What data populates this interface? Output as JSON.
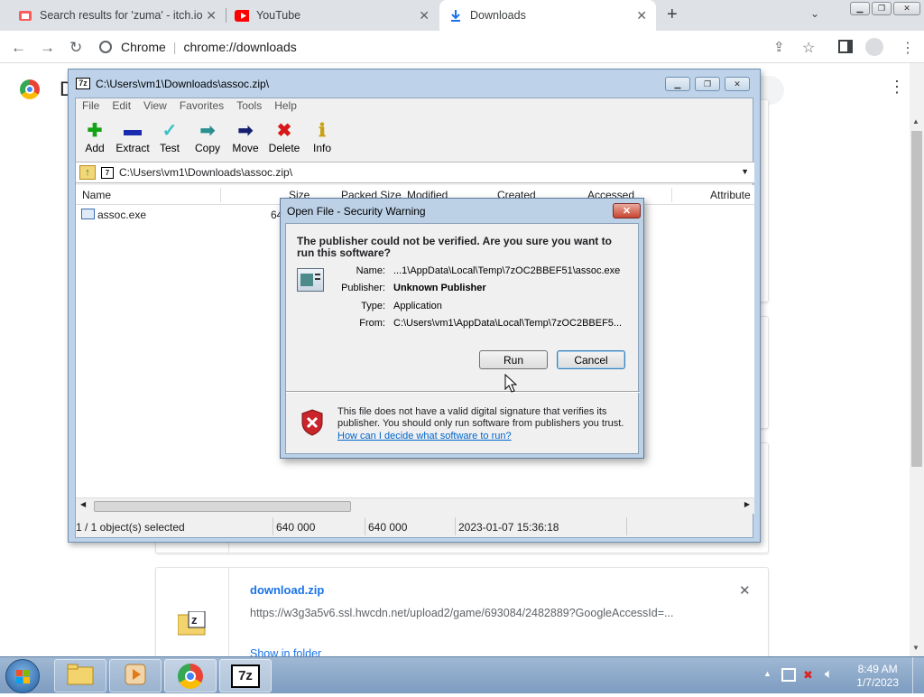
{
  "browser": {
    "tabs": [
      {
        "label": "Search results for 'zuma' - itch.io",
        "icon": "itchio-icon"
      },
      {
        "label": "YouTube",
        "icon": "youtube-icon"
      },
      {
        "label": "Downloads",
        "icon": "download-icon"
      }
    ],
    "new_tab_label": "+",
    "omnibox": {
      "site": "Chrome",
      "url": "chrome://downloads"
    }
  },
  "downloads_page": {
    "header_letter": "D",
    "item": {
      "filename": "download.zip",
      "url": "https://w3g3a5v6.ssl.hwcdn.net/upload2/game/693084/2482889?GoogleAccessId=...",
      "show_in_folder": "Show in folder"
    }
  },
  "zip_window": {
    "title": "C:\\Users\\vm1\\Downloads\\assoc.zip\\",
    "menu": [
      "File",
      "Edit",
      "View",
      "Favorites",
      "Tools",
      "Help"
    ],
    "toolbar": [
      {
        "label": "Add",
        "icon": "plus-icon",
        "glyph": "✚",
        "color": "#12a412"
      },
      {
        "label": "Extract",
        "icon": "minus-icon",
        "glyph": "▬",
        "color": "#1a2bb0"
      },
      {
        "label": "Test",
        "icon": "check-icon",
        "glyph": "✓",
        "color": "#3bbfc9"
      },
      {
        "label": "Copy",
        "icon": "copy-arrow-icon",
        "glyph": "➡",
        "color": "#2a8f8f"
      },
      {
        "label": "Move",
        "icon": "move-arrow-icon",
        "glyph": "➡",
        "color": "#14206e"
      },
      {
        "label": "Delete",
        "icon": "delete-x-icon",
        "glyph": "✖",
        "color": "#d81818"
      },
      {
        "label": "Info",
        "icon": "info-icon",
        "glyph": "ℹ",
        "color": "#caa010"
      }
    ],
    "path": "C:\\Users\\vm1\\Downloads\\assoc.zip\\",
    "columns": [
      "Name",
      "Size",
      "Packed Size",
      "Modified",
      "Created",
      "Accessed",
      "Attribute"
    ],
    "rows": [
      {
        "name": "assoc.exe",
        "size": "64"
      }
    ],
    "status": {
      "selection": "1 / 1 object(s) selected",
      "size": "640 000",
      "packed": "640 000",
      "date": "2023-01-07 15:36:18"
    }
  },
  "dialog": {
    "title": "Open File - Security Warning",
    "question": "The publisher could not be verified.  Are you sure you want to run this software?",
    "fields": [
      {
        "label": "Name:",
        "value": "...1\\AppData\\Local\\Temp\\7zOC2BBEF51\\assoc.exe",
        "bold": false
      },
      {
        "label": "Publisher:",
        "value": "Unknown Publisher",
        "bold": true
      },
      {
        "label": "Type:",
        "value": "Application",
        "bold": false
      },
      {
        "label": "From:",
        "value": "C:\\Users\\vm1\\AppData\\Local\\Temp\\7zOC2BBEF5...",
        "bold": false
      }
    ],
    "run_label": "Run",
    "cancel_label": "Cancel",
    "warning": "This file does not have a valid digital signature that verifies its publisher.  You should only run software from publishers you trust.",
    "help_link": "How can I decide what software to run?"
  },
  "taskbar": {
    "time": "8:49 AM",
    "date": "1/7/2023"
  }
}
